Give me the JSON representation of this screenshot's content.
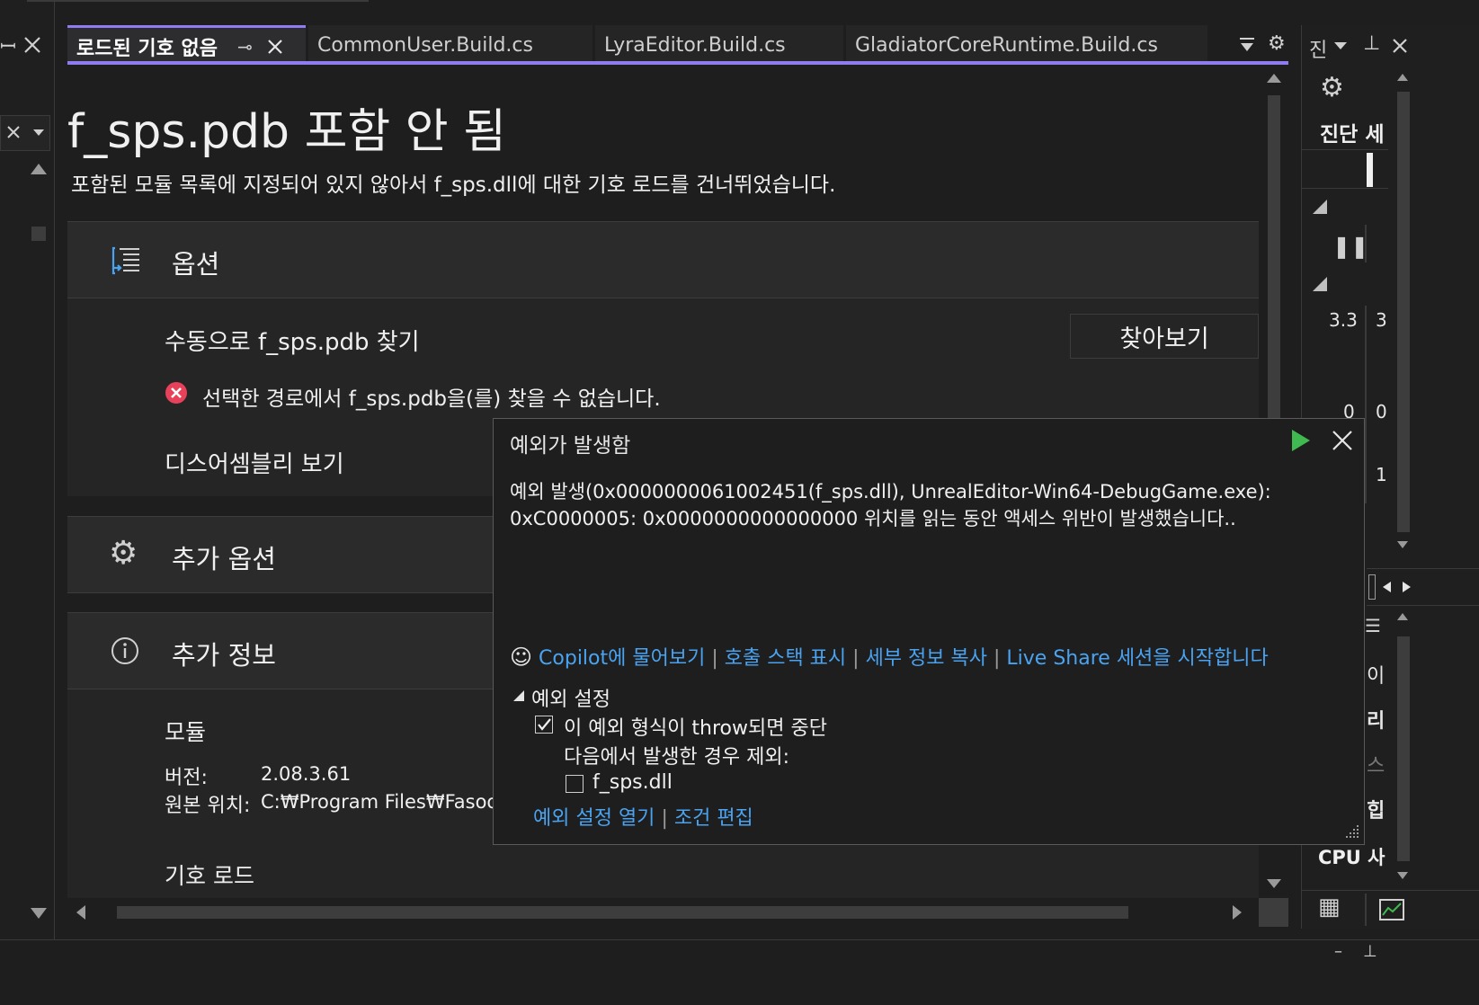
{
  "tabs": [
    {
      "label": "로드된 기호 없음",
      "active": true
    },
    {
      "label": "CommonUser.Build.cs",
      "active": false
    },
    {
      "label": "LyraEditor.Build.cs",
      "active": false
    },
    {
      "label": "GladiatorCoreRuntime.Build.cs",
      "active": false
    }
  ],
  "doc": {
    "title": "f_sps.pdb 포함 안 됨",
    "subtitle": "포함된 모듈 목록에 지정되어 있지 않아서 f_sps.dll에 대한 기호 로드를 건너뛰었습니다.",
    "options": {
      "header": "옵션",
      "find_manual": "수동으로 f_sps.pdb 찾기",
      "browse_button": "찾아보기",
      "error_text": "선택한 경로에서 f_sps.pdb을(를) 찾을 수 없습니다.",
      "disassembly_link": "디스어셈블리 보기"
    },
    "extra_options": {
      "header": "추가 옵션"
    },
    "extra_info": {
      "header": "추가 정보",
      "module_label": "모듈",
      "version_label": "버전:",
      "version_value": "2.08.3.61",
      "origin_label": "원본 위치:",
      "origin_value": "C:₩Program Files₩Fasoo",
      "symbol_load_label": "기호 로드"
    }
  },
  "exception_popup": {
    "title": "예외가 발생함",
    "message_line1": "예외 발생(0x0000000061002451(f_sps.dll), UnrealEditor-Win64-DebugGame.exe):",
    "message_line2": "0xC0000005: 0x0000000000000000 위치를 읽는 동안 액세스 위반이 발생했습니다..",
    "links": {
      "copilot": "Copilot에 물어보기",
      "call_stack": "호출 스택 표시",
      "copy_details": "세부 정보 복사",
      "live_share": "Live Share 세션을 시작합니다"
    },
    "settings_header": "예외 설정",
    "break_checkbox_label": "이 예외 형식이 throw되면 중단",
    "break_checked": true,
    "except_label": "다음에서 발생한 경우 제외:",
    "module_checkbox_label": "f_sps.dll",
    "module_checked": false,
    "open_settings_link": "예외 설정 열기",
    "edit_condition_link": "조건 편집"
  },
  "right_panel": {
    "tab_label": "진",
    "diag_title": "진단 세",
    "value_1": "3.3",
    "value_2": "3",
    "value_3": "0",
    "value_4": "0",
    "value_5": "1",
    "cpu_label": "CPU 사",
    "frag_1": "이",
    "frag_2": "리",
    "frag_3": "스",
    "frag_4": "힙"
  },
  "colors": {
    "accent": "#8e7cf0",
    "link": "#4aa3f0",
    "error": "#e8415a",
    "run": "#3fb950"
  }
}
